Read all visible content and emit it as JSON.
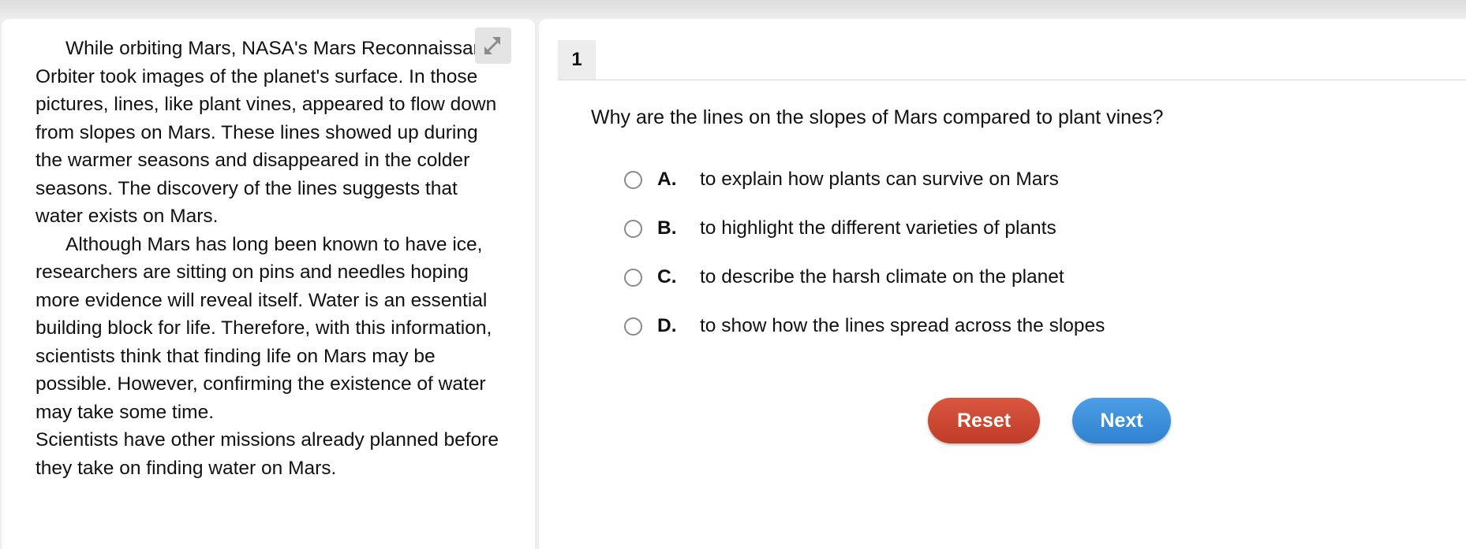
{
  "passage": {
    "paragraphs": [
      "While orbiting Mars, NASA's Mars Reconnaissance Orbiter took images of the planet's surface. In those pictures, lines, like plant vines, appeared to flow down from slopes on Mars. These lines showed up during the warmer seasons and disappeared in the colder seasons. The discovery of the lines suggests that water exists on Mars.",
      "Although Mars has long been known to have ice, researchers are sitting on pins and needles hoping more evidence will reveal itself. Water is an essential building block for life. Therefore, with this information, scientists think that finding life on Mars may be possible. However, confirming the existence of water may take some time.",
      "Scientists have other missions already planned before they take on finding water on Mars."
    ],
    "expand_icon": "expand-arrows-icon"
  },
  "question": {
    "number": "1",
    "prompt": "Why are the lines on the slopes of Mars compared to plant vines?",
    "options": [
      {
        "letter": "A.",
        "text": "to explain how plants can survive on Mars"
      },
      {
        "letter": "B.",
        "text": "to highlight the different varieties of plants"
      },
      {
        "letter": "C.",
        "text": "to describe the harsh climate on the planet"
      },
      {
        "letter": "D.",
        "text": "to show how the lines spread across the slopes"
      }
    ]
  },
  "buttons": {
    "reset_label": "Reset",
    "next_label": "Next",
    "reset_color": "#c9452f",
    "next_color": "#3a8fdc"
  }
}
